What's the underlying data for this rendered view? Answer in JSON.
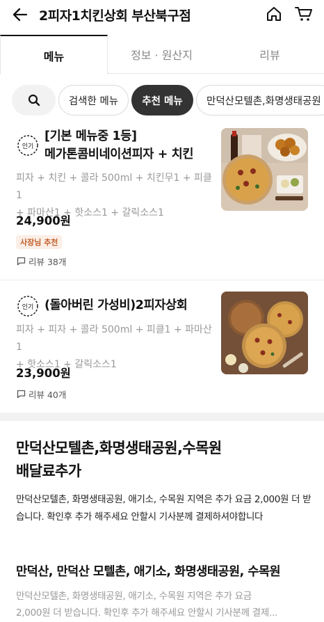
{
  "header": {
    "title": "2피자1치킨상회 부산북구점",
    "back_icon": "arrow-left-icon",
    "home_icon": "home-icon",
    "cart_icon": "cart-icon"
  },
  "tabs": [
    {
      "label": "메뉴",
      "active": true
    },
    {
      "label": "정보 · 원산지",
      "active": false
    },
    {
      "label": "리뷰",
      "active": false
    }
  ],
  "chips": {
    "search_icon": "search-icon",
    "searched": "검색한 메뉴",
    "recommended": "추천 메뉴",
    "area": "만덕산모텔촌,화명생태공원"
  },
  "menu_items": [
    {
      "badge": "인기",
      "title_line1": "[기본 메뉴중 1등]",
      "title_line2": "메가톤콤비네이션피자 + 치킨",
      "desc_line1": "피자 + 치킨 + 콜라 500ml + 치킨무1 + 피클1",
      "desc_line2": "+ 파마산1 + 핫소스1 + 갈릭소스1",
      "price": "24,900원",
      "owner_pick": "사장님 추천",
      "review": "리뷰 38개"
    },
    {
      "badge": "인기",
      "title_line1": "(돌아버린 가성비)2피자상회",
      "desc_line1": "피자 + 피자 + 콜라 500ml  + 피클1 + 파마산1",
      "desc_line2": "+ 핫소스1 + 갈릭소스1",
      "price": "23,900원",
      "review": "리뷰 40개"
    }
  ],
  "section": {
    "title_line1": "만덕산모텔촌,화명생태공원,수목원",
    "title_line2": "배달료추가",
    "desc": "만덕산모텔촌, 화명생태공원, 애기소, 수목원 지역은 추가 요금 2,000원 더 받습니다.  확인후 추가 해주세요 안할시 기사분께 결제하셔야합니다",
    "sub_title": "만덕산, 만덕산 모텔촌, 애기소, 화명생태공원, 수목원",
    "sub_desc_line1": "만덕산모텔촌, 화명생태공원, 애기소, 수목원 지역은 추가 요금",
    "sub_desc_line2": "2,000원 더 받습니다.  확인후 추가 해주세요 안할시 기사분께 결제..."
  },
  "colors": {
    "active_chip_bg": "#333333",
    "owner_pick_bg": "#fbeee6",
    "owner_pick_text": "#c2602d"
  }
}
